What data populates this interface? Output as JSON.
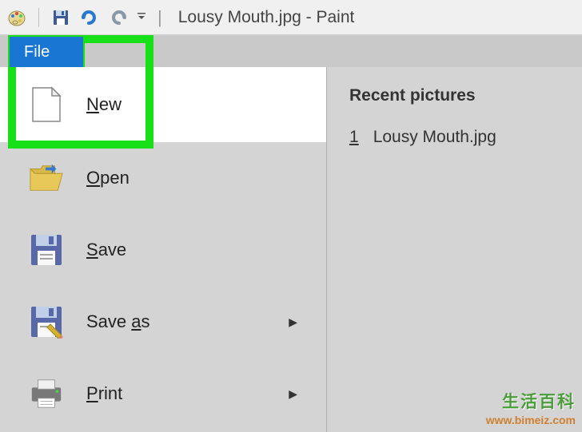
{
  "titlebar": {
    "title": "Lousy Mouth.jpg - Paint"
  },
  "file_tab": {
    "label": "File"
  },
  "menu": {
    "new_label": "ew",
    "new_accel": "N",
    "open_label": "pen",
    "open_accel": "O",
    "save_label": "ave",
    "save_accel": "S",
    "saveas_label": "Save ",
    "saveas_accel": "a",
    "saveas_suffix": "s",
    "print_label": "rint",
    "print_accel": "P"
  },
  "recent": {
    "title": "Recent pictures",
    "items": [
      {
        "num": "1",
        "name": "Lousy Mouth.jpg"
      }
    ]
  },
  "watermark": {
    "cn": "生活百科",
    "url": "www.bimeiz.com"
  }
}
